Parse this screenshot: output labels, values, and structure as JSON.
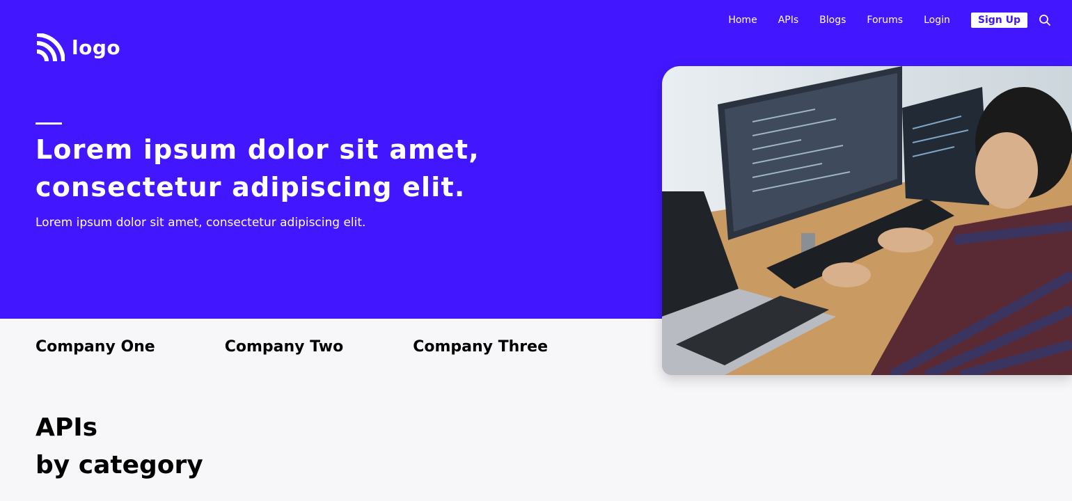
{
  "brand": {
    "logo_text": "logo"
  },
  "nav": {
    "items": [
      {
        "label": "Home"
      },
      {
        "label": "APIs"
      },
      {
        "label": "Blogs"
      },
      {
        "label": "Forums"
      },
      {
        "label": "Login"
      }
    ],
    "signup_label": "Sign Up",
    "search_icon": "search-icon"
  },
  "hero": {
    "headline_line1": "Lorem ipsum dolor sit amet,",
    "headline_line2": "consectetur adipiscing elit.",
    "subtitle": "Lorem ipsum dolor sit amet, consectetur adipiscing elit.",
    "image": "developer-at-computers-photo"
  },
  "companies": [
    "Company One",
    "Company Two",
    "Company Three"
  ],
  "apis_section": {
    "title_line1": "APIs",
    "title_line2": "by category"
  },
  "colors": {
    "accent": "#4217ff",
    "background": "#f7f7f9",
    "text": "#000000"
  }
}
